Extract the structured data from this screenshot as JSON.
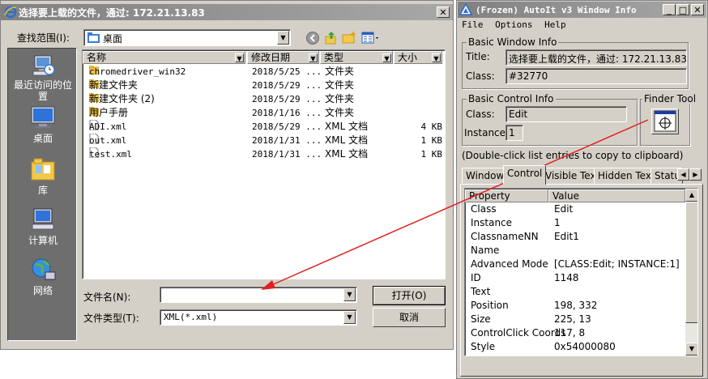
{
  "dialog": {
    "title": "选择要上载的文件，通过: 172.21.13.83",
    "look_in_label": "查找范围(I):",
    "look_in_value": "桌面",
    "places": [
      {
        "label": "最近访问的位置",
        "icon": "recent-places-icon"
      },
      {
        "label": "桌面",
        "icon": "desktop-icon"
      },
      {
        "label": "库",
        "icon": "library-icon"
      },
      {
        "label": "计算机",
        "icon": "computer-icon"
      },
      {
        "label": "网络",
        "icon": "network-icon"
      }
    ],
    "columns": {
      "name": "名称",
      "date": "修改日期",
      "type": "类型",
      "size": "大小"
    },
    "files": [
      {
        "name": "chromedriver_win32",
        "date": "2018/5/25 ...",
        "type": "文件夹",
        "size": "",
        "kind": "folder"
      },
      {
        "name": "新建文件夹",
        "date": "2018/5/29 ...",
        "type": "文件夹",
        "size": "",
        "kind": "folder"
      },
      {
        "name": "新建文件夹 (2)",
        "date": "2018/5/29 ...",
        "type": "文件夹",
        "size": "",
        "kind": "folder"
      },
      {
        "name": "用户手册",
        "date": "2018/1/16 ...",
        "type": "文件夹",
        "size": "",
        "kind": "folder"
      },
      {
        "name": "ADI.xml",
        "date": "2018/5/29 ...",
        "type": "XML 文档",
        "size": "4 KB",
        "kind": "file"
      },
      {
        "name": "out.xml",
        "date": "2018/1/31 ...",
        "type": "XML 文档",
        "size": "1 KB",
        "kind": "file"
      },
      {
        "name": "test.xml",
        "date": "2018/1/31 ...",
        "type": "XML 文档",
        "size": "1 KB",
        "kind": "file"
      }
    ],
    "filename_label": "文件名(N):",
    "filename_value": "",
    "filetype_label": "文件类型(T):",
    "filetype_value": "XML(*.xml)",
    "open_button": "打开(O)",
    "cancel_button": "取消"
  },
  "autoit": {
    "title": "(Frozen) AutoIt v3 Window Info",
    "menu": [
      "File",
      "Options",
      "Help"
    ],
    "basic_window_info": {
      "group_label": "Basic Window Info",
      "title_label": "Title:",
      "title_value": "选择要上载的文件，通过: 172.21.13.83",
      "class_label": "Class:",
      "class_value": "#32770"
    },
    "basic_control_info": {
      "group_label": "Basic Control Info",
      "class_label": "Class:",
      "class_value": "Edit",
      "instance_label": "Instance:",
      "instance_value": "1"
    },
    "finder_tool_label": "Finder Tool",
    "hint": "(Double-click list entries to copy to clipboard)",
    "tabs": [
      "Window",
      "Control",
      "Visible Text",
      "Hidden Text",
      "Status"
    ],
    "active_tab": "Control",
    "list_headers": {
      "property": "Property",
      "value": "Value"
    },
    "properties": [
      {
        "property": "Class",
        "value": "Edit"
      },
      {
        "property": "Instance",
        "value": "1"
      },
      {
        "property": "ClassnameNN",
        "value": "Edit1"
      },
      {
        "property": "Name",
        "value": ""
      },
      {
        "property": "Advanced Mode",
        "value": "[CLASS:Edit; INSTANCE:1]"
      },
      {
        "property": "ID",
        "value": "1148"
      },
      {
        "property": "Text",
        "value": ""
      },
      {
        "property": "Position",
        "value": "198, 332"
      },
      {
        "property": "Size",
        "value": "225, 13"
      },
      {
        "property": "ControlClick Coords",
        "value": "117, 8"
      },
      {
        "property": "Style",
        "value": "0x54000080"
      }
    ]
  },
  "colors": {
    "arrow": "#e02020",
    "places_bg": "#6e6e6e",
    "titlebar_inactive": "#808080"
  }
}
